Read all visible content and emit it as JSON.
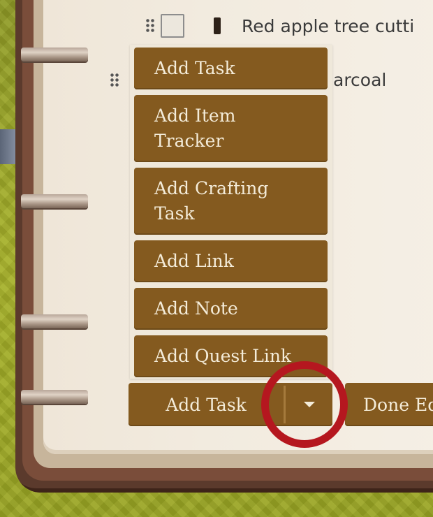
{
  "checklist": {
    "rows": [
      {
        "text": "Red apple tree cutti"
      },
      {
        "text": "arcoal"
      }
    ]
  },
  "dropdown": {
    "items": [
      {
        "label": "Add Task"
      },
      {
        "label": "Add Item Tracker"
      },
      {
        "label": "Add Crafting Task"
      },
      {
        "label": "Add Link"
      },
      {
        "label": "Add Note"
      },
      {
        "label": "Add Quest Link"
      }
    ]
  },
  "controls": {
    "add_task_label": "Add Task",
    "toggle_icon": "caret-down-icon",
    "done_label": "Done Ed"
  },
  "colors": {
    "button": "#845a1f",
    "button_text": "#f4ecd9",
    "page": "#f2ebdf",
    "highlight": "#b5171f"
  }
}
